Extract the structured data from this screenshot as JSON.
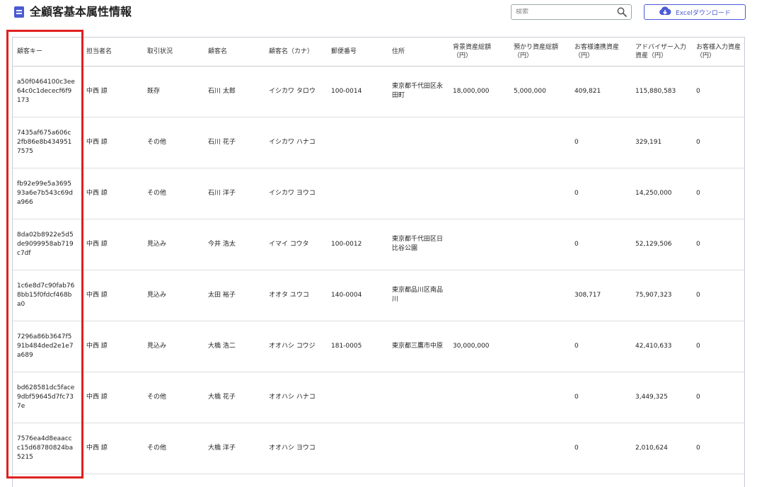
{
  "header": {
    "title": "全顧客基本属性情報",
    "search_placeholder": "検索",
    "excel_button": "Excelダウンロード"
  },
  "table": {
    "columns": [
      "顧客キー",
      "担当者名",
      "取引状況",
      "顧客名",
      "顧客名（カナ）",
      "郵便番号",
      "住所",
      "背景資産総額（円）",
      "預かり資産総額（円）",
      "お客様連携資産（円）",
      "アドバイザー入力資産（円）",
      "お客様入力資産（円）"
    ],
    "rows": [
      [
        "a50f0464100c3ee64c0c1dececf6f9173",
        "中西 諒",
        "既存",
        "石川 太郎",
        "イシカワ タロウ",
        "100-0014",
        "東京都千代田区永田町",
        "18,000,000",
        "5,000,000",
        "409,821",
        "115,880,583",
        "0"
      ],
      [
        "7435af675a606c2fb86e8b4349517575",
        "中西 諒",
        "その他",
        "石川 花子",
        "イシカワ ハナコ",
        "",
        "",
        "",
        "",
        "0",
        "329,191",
        "0"
      ],
      [
        "fb92e99e5a369593a6e7b543c69da966",
        "中西 諒",
        "その他",
        "石川 洋子",
        "イシカワ ヨウコ",
        "",
        "",
        "",
        "",
        "0",
        "14,250,000",
        "0"
      ],
      [
        "8da02b8922e5d5de9099958ab719c7df",
        "中西 諒",
        "見込み",
        "今井 浩太",
        "イマイ コウタ",
        "100-0012",
        "東京都千代田区日比谷公園",
        "",
        "",
        "0",
        "52,129,506",
        "0"
      ],
      [
        "1c6e8d7c90fab768bb15f0fdcf468ba0",
        "中西 諒",
        "見込み",
        "太田 裕子",
        "オオタ ユウコ",
        "140-0004",
        "東京都品川区南品川",
        "",
        "",
        "308,717",
        "75,907,323",
        "0"
      ],
      [
        "7296a86b3647f591b484ded2e1e7a689",
        "中西 諒",
        "見込み",
        "大橋 浩二",
        "オオハシ コウジ",
        "181-0005",
        "東京都三鷹市中原",
        "30,000,000",
        "",
        "0",
        "42,410,633",
        "0"
      ],
      [
        "bd628581dc5face9dbf59645d7fc737e",
        "中西 諒",
        "その他",
        "大橋 花子",
        "オオハシ ハナコ",
        "",
        "",
        "",
        "",
        "0",
        "3,449,325",
        "0"
      ],
      [
        "7576ea4d8eaaccc15d68780824ba5215",
        "中西 諒",
        "その他",
        "大橋 洋子",
        "オオハシ ヨウコ",
        "",
        "",
        "",
        "",
        "0",
        "2,010,624",
        "0"
      ]
    ]
  }
}
